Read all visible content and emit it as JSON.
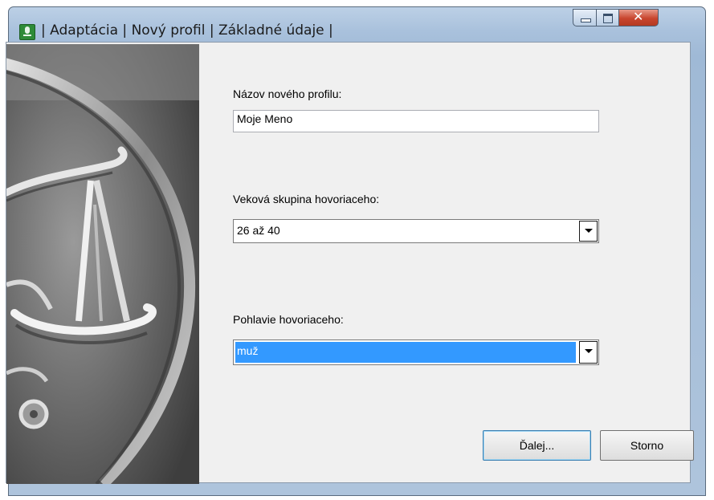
{
  "window": {
    "title": "| Adaptácia | Nový profil | Základné údaje |",
    "icon": "microphone-icon"
  },
  "form": {
    "profile_name_label": "Názov nového profilu:",
    "profile_name_value": "Moje Meno",
    "age_group_label": "Veková skupina hovoriaceho:",
    "age_group_value": "26 až 40",
    "gender_label": "Pohlavie hovoriaceho:",
    "gender_value": "muž"
  },
  "buttons": {
    "next_label": "Ďalej...",
    "cancel_label": "Storno"
  },
  "colors": {
    "selection": "#3399ff",
    "titlebar": "#a9c1dc",
    "close_button": "#c8452e"
  }
}
